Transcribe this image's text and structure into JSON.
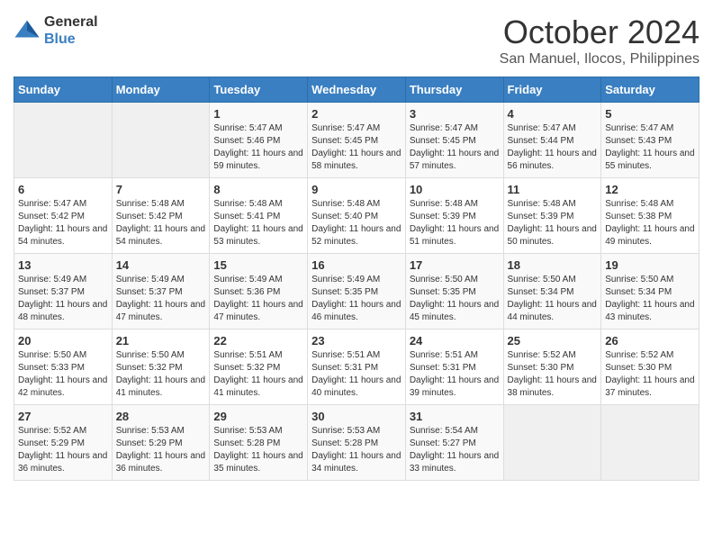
{
  "logo": {
    "general": "General",
    "blue": "Blue"
  },
  "title": "October 2024",
  "subtitle": "San Manuel, Ilocos, Philippines",
  "days_of_week": [
    "Sunday",
    "Monday",
    "Tuesday",
    "Wednesday",
    "Thursday",
    "Friday",
    "Saturday"
  ],
  "weeks": [
    [
      {
        "day": "",
        "empty": true
      },
      {
        "day": "",
        "empty": true
      },
      {
        "day": "1",
        "sunrise": "5:47 AM",
        "sunset": "5:46 PM",
        "daylight": "11 hours and 59 minutes."
      },
      {
        "day": "2",
        "sunrise": "5:47 AM",
        "sunset": "5:45 PM",
        "daylight": "11 hours and 58 minutes."
      },
      {
        "day": "3",
        "sunrise": "5:47 AM",
        "sunset": "5:45 PM",
        "daylight": "11 hours and 57 minutes."
      },
      {
        "day": "4",
        "sunrise": "5:47 AM",
        "sunset": "5:44 PM",
        "daylight": "11 hours and 56 minutes."
      },
      {
        "day": "5",
        "sunrise": "5:47 AM",
        "sunset": "5:43 PM",
        "daylight": "11 hours and 55 minutes."
      }
    ],
    [
      {
        "day": "6",
        "sunrise": "5:47 AM",
        "sunset": "5:42 PM",
        "daylight": "11 hours and 54 minutes."
      },
      {
        "day": "7",
        "sunrise": "5:48 AM",
        "sunset": "5:42 PM",
        "daylight": "11 hours and 54 minutes."
      },
      {
        "day": "8",
        "sunrise": "5:48 AM",
        "sunset": "5:41 PM",
        "daylight": "11 hours and 53 minutes."
      },
      {
        "day": "9",
        "sunrise": "5:48 AM",
        "sunset": "5:40 PM",
        "daylight": "11 hours and 52 minutes."
      },
      {
        "day": "10",
        "sunrise": "5:48 AM",
        "sunset": "5:39 PM",
        "daylight": "11 hours and 51 minutes."
      },
      {
        "day": "11",
        "sunrise": "5:48 AM",
        "sunset": "5:39 PM",
        "daylight": "11 hours and 50 minutes."
      },
      {
        "day": "12",
        "sunrise": "5:48 AM",
        "sunset": "5:38 PM",
        "daylight": "11 hours and 49 minutes."
      }
    ],
    [
      {
        "day": "13",
        "sunrise": "5:49 AM",
        "sunset": "5:37 PM",
        "daylight": "11 hours and 48 minutes."
      },
      {
        "day": "14",
        "sunrise": "5:49 AM",
        "sunset": "5:37 PM",
        "daylight": "11 hours and 47 minutes."
      },
      {
        "day": "15",
        "sunrise": "5:49 AM",
        "sunset": "5:36 PM",
        "daylight": "11 hours and 47 minutes."
      },
      {
        "day": "16",
        "sunrise": "5:49 AM",
        "sunset": "5:35 PM",
        "daylight": "11 hours and 46 minutes."
      },
      {
        "day": "17",
        "sunrise": "5:50 AM",
        "sunset": "5:35 PM",
        "daylight": "11 hours and 45 minutes."
      },
      {
        "day": "18",
        "sunrise": "5:50 AM",
        "sunset": "5:34 PM",
        "daylight": "11 hours and 44 minutes."
      },
      {
        "day": "19",
        "sunrise": "5:50 AM",
        "sunset": "5:34 PM",
        "daylight": "11 hours and 43 minutes."
      }
    ],
    [
      {
        "day": "20",
        "sunrise": "5:50 AM",
        "sunset": "5:33 PM",
        "daylight": "11 hours and 42 minutes."
      },
      {
        "day": "21",
        "sunrise": "5:50 AM",
        "sunset": "5:32 PM",
        "daylight": "11 hours and 41 minutes."
      },
      {
        "day": "22",
        "sunrise": "5:51 AM",
        "sunset": "5:32 PM",
        "daylight": "11 hours and 41 minutes."
      },
      {
        "day": "23",
        "sunrise": "5:51 AM",
        "sunset": "5:31 PM",
        "daylight": "11 hours and 40 minutes."
      },
      {
        "day": "24",
        "sunrise": "5:51 AM",
        "sunset": "5:31 PM",
        "daylight": "11 hours and 39 minutes."
      },
      {
        "day": "25",
        "sunrise": "5:52 AM",
        "sunset": "5:30 PM",
        "daylight": "11 hours and 38 minutes."
      },
      {
        "day": "26",
        "sunrise": "5:52 AM",
        "sunset": "5:30 PM",
        "daylight": "11 hours and 37 minutes."
      }
    ],
    [
      {
        "day": "27",
        "sunrise": "5:52 AM",
        "sunset": "5:29 PM",
        "daylight": "11 hours and 36 minutes."
      },
      {
        "day": "28",
        "sunrise": "5:53 AM",
        "sunset": "5:29 PM",
        "daylight": "11 hours and 36 minutes."
      },
      {
        "day": "29",
        "sunrise": "5:53 AM",
        "sunset": "5:28 PM",
        "daylight": "11 hours and 35 minutes."
      },
      {
        "day": "30",
        "sunrise": "5:53 AM",
        "sunset": "5:28 PM",
        "daylight": "11 hours and 34 minutes."
      },
      {
        "day": "31",
        "sunrise": "5:54 AM",
        "sunset": "5:27 PM",
        "daylight": "11 hours and 33 minutes."
      },
      {
        "day": "",
        "empty": true
      },
      {
        "day": "",
        "empty": true
      }
    ]
  ],
  "labels": {
    "sunrise": "Sunrise:",
    "sunset": "Sunset:",
    "daylight": "Daylight:"
  }
}
